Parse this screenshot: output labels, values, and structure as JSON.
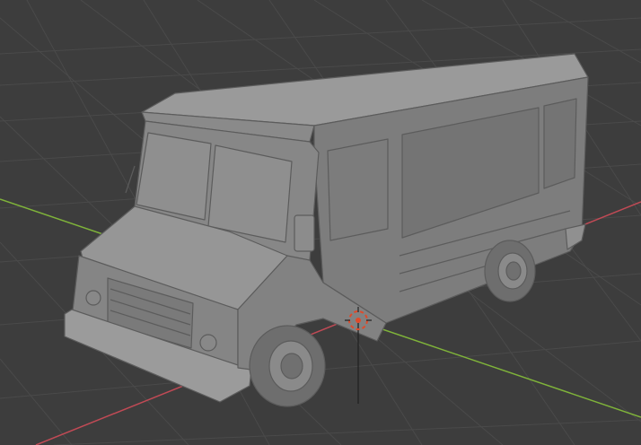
{
  "viewport": {
    "mode": "solid",
    "background": "#3d3d3d",
    "grid_color": "#4a4a4a",
    "axis_x_color": "#c04a55",
    "axis_y_color": "#7fb33a",
    "axis_z_visible": true
  },
  "scene": {
    "object": "delivery-van",
    "object_color": "#8e8e8e",
    "origin_marker_color": "#e04a2a",
    "cursor_3d": "3d-cursor-icon"
  }
}
